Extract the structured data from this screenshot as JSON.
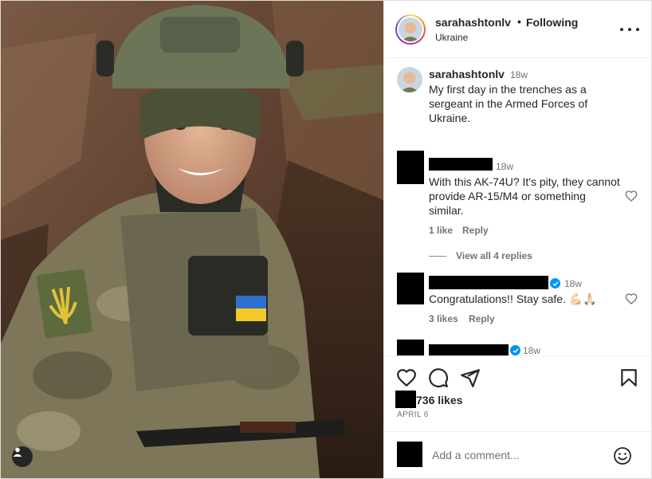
{
  "header": {
    "username": "sarahashtonlv",
    "dot": "•",
    "follow_status": "Following",
    "location": "Ukraine"
  },
  "caption": {
    "username": "sarahashtonlv",
    "time": "18w",
    "text": "My first day in the trenches as a sergeant in the Armed Forces of Ukraine."
  },
  "comments": [
    {
      "time": "18w",
      "text": "With this AK-74U? It's pity, they cannot provide AR-15/M4 or something similar.",
      "likes": "1 like",
      "reply": "Reply",
      "view_replies": "View all 4 replies",
      "verified": false
    },
    {
      "time": "18w",
      "text": "Congratulations!! Stay safe. 💪🏻🙏🏻",
      "likes": "3 likes",
      "reply": "Reply",
      "verified": true
    },
    {
      "time": "18w",
      "verified": true
    }
  ],
  "likes_count": "736 likes",
  "post_date": "APRIL 6",
  "add_comment": {
    "placeholder": "Add a comment..."
  },
  "icons": {
    "like": "heart-icon",
    "comment": "comment-icon",
    "share": "send-icon",
    "save": "bookmark-icon",
    "emoji": "emoji-icon",
    "more": "more-options-icon",
    "tags": "user-tag-icon"
  },
  "colors": {
    "verified": "#0095f6",
    "secondary_text": "#737373",
    "primary_text": "#262626"
  }
}
